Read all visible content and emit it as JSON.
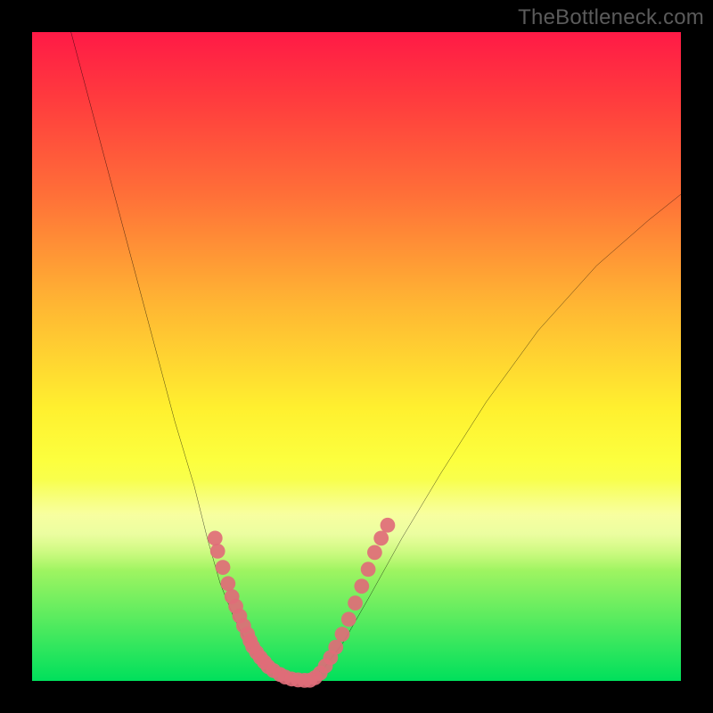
{
  "watermark": "TheBottleneck.com",
  "chart_data": {
    "type": "line",
    "title": "",
    "xlabel": "",
    "ylabel": "",
    "xlim": [
      0,
      100
    ],
    "ylim": [
      0,
      100
    ],
    "grid": false,
    "legend": false,
    "series": [
      {
        "name": "left-curve",
        "stroke": "#000000",
        "x": [
          6,
          10,
          14,
          18,
          22,
          25,
          27,
          29,
          31,
          33,
          35,
          36,
          37
        ],
        "y": [
          100,
          85,
          70,
          55,
          40,
          30,
          22,
          15,
          10,
          6,
          3,
          1.5,
          0.5
        ]
      },
      {
        "name": "right-curve",
        "stroke": "#000000",
        "x": [
          43,
          45,
          48,
          52,
          57,
          63,
          70,
          78,
          87,
          95,
          100
        ],
        "y": [
          0.5,
          2,
          6,
          13,
          22,
          32,
          43,
          54,
          64,
          71,
          75
        ]
      },
      {
        "name": "left-dots",
        "stroke": "#e06c78",
        "marker": "circle",
        "x": [
          28.2,
          28.6,
          29.4,
          30.2,
          30.8,
          31.4,
          32.0,
          32.6,
          33.2,
          33.6,
          34.0,
          34.6,
          35.2,
          35.8,
          36.4,
          37.2,
          38.2,
          39.0,
          40.0,
          41.0,
          42.0
        ],
        "y": [
          22.0,
          20.0,
          17.5,
          15.0,
          13.0,
          11.5,
          10.0,
          8.5,
          7.2,
          6.2,
          5.3,
          4.4,
          3.6,
          2.9,
          2.2,
          1.6,
          1.0,
          0.6,
          0.3,
          0.15,
          0.08
        ]
      },
      {
        "name": "right-dots",
        "stroke": "#e06c78",
        "marker": "circle",
        "x": [
          42.8,
          43.6,
          44.4,
          45.2,
          46.0,
          46.8,
          47.8,
          48.8,
          49.8,
          50.8,
          51.8,
          52.8,
          53.8,
          54.8
        ],
        "y": [
          0.1,
          0.5,
          1.2,
          2.3,
          3.6,
          5.2,
          7.2,
          9.5,
          12.0,
          14.6,
          17.2,
          19.8,
          22.0,
          24.0
        ]
      }
    ],
    "colors": {
      "gradient_top": "#ff1a46",
      "gradient_mid": "#fff02f",
      "gradient_bottom": "#00e05c",
      "curve": "#000000",
      "dots": "#e06c78"
    }
  }
}
